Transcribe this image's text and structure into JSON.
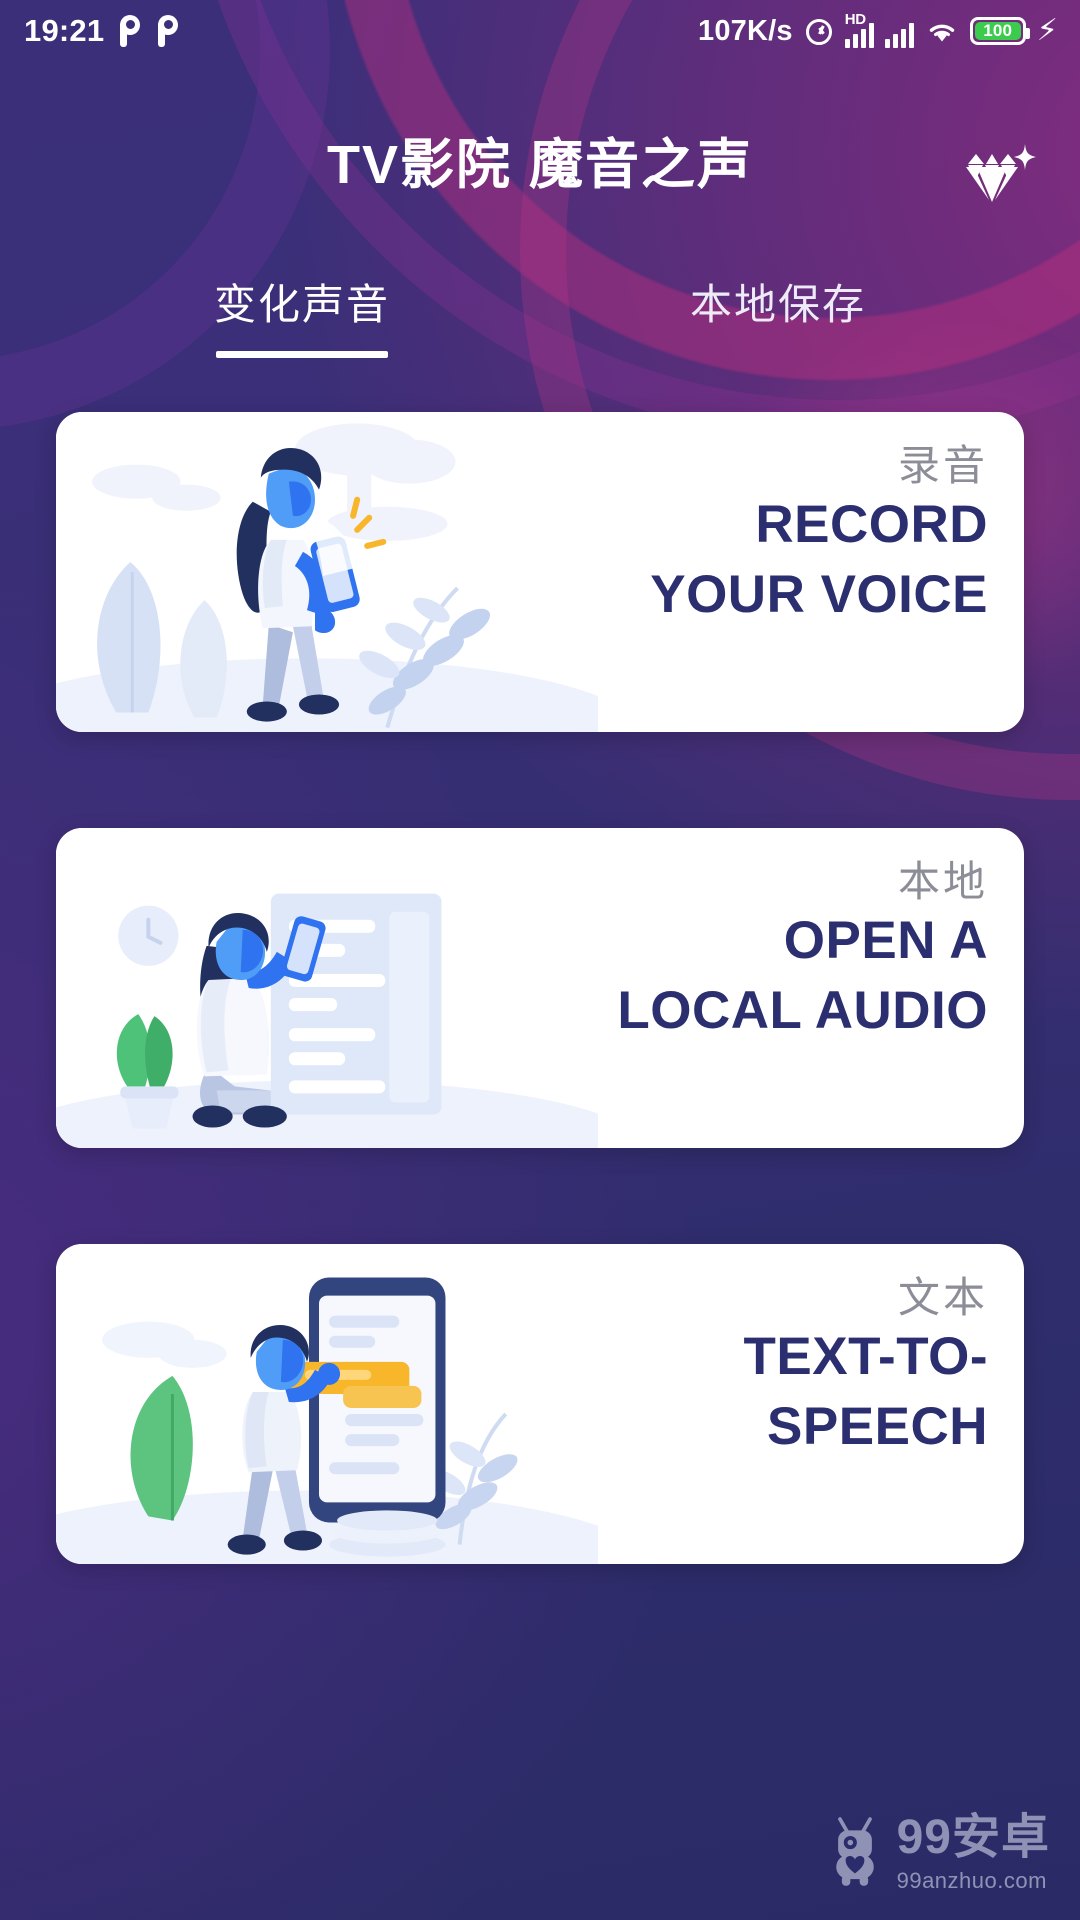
{
  "statusbar": {
    "time": "19:21",
    "icons_left": [
      "pin-icon",
      "pin-icon"
    ],
    "network_speed": "107K/s",
    "alarm": "alarm-icon",
    "hd_label": "HD",
    "signal_1": "signal-bars-icon",
    "signal_2": "signal-bars-icon",
    "wifi": "wifi-icon",
    "battery_level": "100",
    "charging": "⚡",
    "battery_color": "#3ccb4d"
  },
  "header": {
    "title": "TV影院 魔音之声",
    "vip_icon": "diamond-icon"
  },
  "tabs": [
    {
      "label": "变化声音",
      "active": true
    },
    {
      "label": "本地保存",
      "active": false
    }
  ],
  "cards": [
    {
      "cn_label": "录音",
      "en_line1": "RECORD",
      "en_line2": "YOUR VOICE",
      "illustration": "woman-recording-voice-with-phone"
    },
    {
      "cn_label": "本地",
      "en_line1": "OPEN A",
      "en_line2": "LOCAL AUDIO",
      "illustration": "woman-with-document-list-and-phone"
    },
    {
      "cn_label": "文本",
      "en_line1": "TEXT-TO-",
      "en_line2": "SPEECH",
      "illustration": "man-with-large-phone-chat-bubbles"
    }
  ],
  "watermark": {
    "main": "99安卓",
    "sub": "99anzhuo.com",
    "icon": "android-robot-icon"
  },
  "colors": {
    "background_top": "#3b2f7a",
    "background_bottom": "#2a2b66",
    "accent_magenta": "#c4307e",
    "card_bg": "#ffffff",
    "card_text": "#2b2f70",
    "card_label": "#8d8d98",
    "illustration_blue": "#3b7ff5",
    "illustration_dark": "#23305e",
    "illustration_light": "#dfe6f7"
  }
}
